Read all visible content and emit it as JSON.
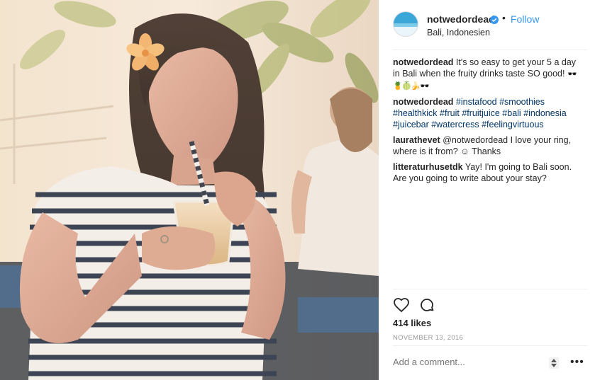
{
  "post": {
    "username": "notwedordead",
    "verified": true,
    "follow_label": "Follow",
    "separator": "•",
    "location": "Bali, Indonesien",
    "comments": [
      {
        "user": "notwedordead",
        "text": "It's so easy to get your 5 a day in Bali when the fruity drinks taste SO good!",
        "emoji": "🕶️🍍🍈🍌🕶️"
      },
      {
        "user": "notwedordead",
        "tags": [
          "#instafood",
          "#smoothies",
          "#healthkick",
          "#fruit",
          "#fruitjuice",
          "#bali",
          "#indonesia",
          "#juicebar",
          "#watercress",
          "#feelingvirtuous"
        ]
      },
      {
        "user": "laurathevet",
        "text": "@notwedordead I love your ring, where is it from? ☺ Thanks"
      },
      {
        "user": "litteraturhusetdk",
        "text": "Yay! I'm going to Bali soon. Are you going to write about your stay?"
      }
    ],
    "likes": "414 likes",
    "date": "NOVEMBER 13, 2016",
    "add_comment_placeholder": "Add a comment...",
    "more_label": "•••"
  },
  "icons": {
    "like": "heart-icon",
    "comment": "comment-icon",
    "verified": "verified-badge-icon",
    "sort": "up-down-icon"
  },
  "colors": {
    "link": "#3897f0",
    "hashtag": "#003569",
    "verified": "#3897f0",
    "muted": "#999999"
  }
}
